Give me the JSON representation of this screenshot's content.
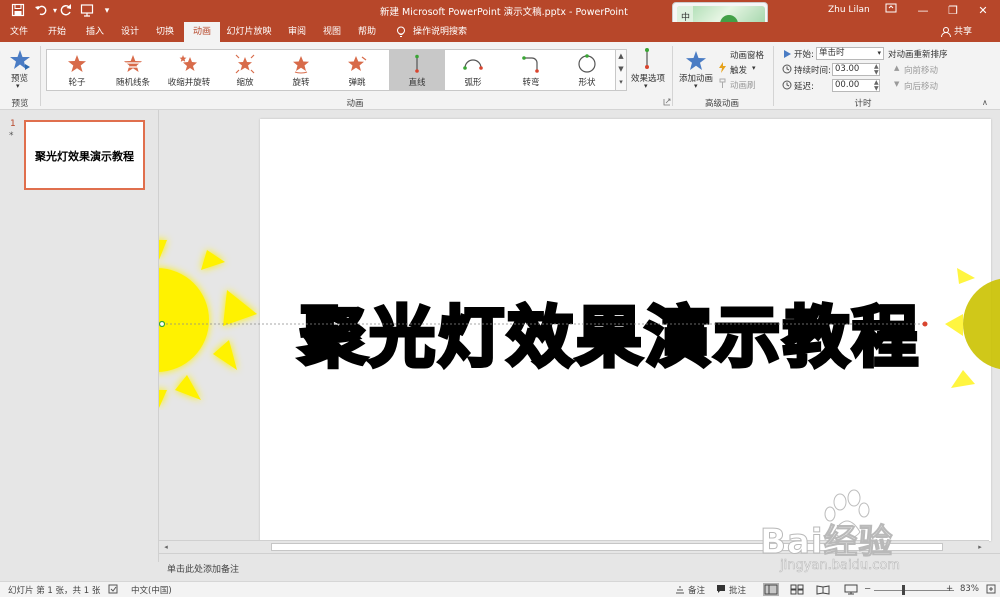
{
  "titlebar": {
    "doc_title": "新建 Microsoft PowerPoint 演示文稿.pptx  -  PowerPoint",
    "user": "Zhu Lilan"
  },
  "tabs": [
    {
      "label": "文件"
    },
    {
      "label": "开始"
    },
    {
      "label": "插入"
    },
    {
      "label": "设计"
    },
    {
      "label": "切换"
    },
    {
      "label": "动画"
    },
    {
      "label": "幻灯片放映"
    },
    {
      "label": "审阅"
    },
    {
      "label": "视图"
    },
    {
      "label": "帮助"
    }
  ],
  "tell_me": "操作说明搜索",
  "share": "共享",
  "ribbon": {
    "preview_label": "预览",
    "preview_group": "预览",
    "animations": [
      {
        "label": "轮子",
        "active": false
      },
      {
        "label": "随机线条",
        "active": false
      },
      {
        "label": "收缩并旋转",
        "active": false
      },
      {
        "label": "缩放",
        "active": false
      },
      {
        "label": "旋转",
        "active": false
      },
      {
        "label": "弹跳",
        "active": false
      },
      {
        "label": "直线",
        "active": true
      },
      {
        "label": "弧形",
        "active": false
      },
      {
        "label": "转弯",
        "active": false
      },
      {
        "label": "形状",
        "active": false
      }
    ],
    "effect_options": "效果选项",
    "animation_group": "动画",
    "add_animation": "添加动画",
    "animation_pane": "动画窗格",
    "trigger": "触发",
    "animation_painter": "动画刷",
    "advanced_group": "高级动画",
    "start_label": "开始:",
    "start_value": "单击时",
    "duration_label": "持续时间:",
    "duration_value": "03.00",
    "delay_label": "延迟:",
    "delay_value": "00.00",
    "reorder_title": "对动画重新排序",
    "move_earlier": "向前移动",
    "move_later": "向后移动",
    "timing_group": "计时"
  },
  "thumbnails": {
    "slide_number": "1",
    "star": "*",
    "thumb_text": "聚光灯效果演示教程"
  },
  "slide": {
    "title": "聚光灯效果演示教程"
  },
  "notes_placeholder": "单击此处添加备注",
  "status": {
    "slide_info": "幻灯片 第 1 张，共 1 张",
    "language": "中文(中国)",
    "notes": "备注",
    "comments": "批注",
    "zoom": "83%"
  },
  "watermark": {
    "line1": "Bai经验",
    "line2": "jingyan.baidu.com"
  },
  "colors": {
    "accent": "#b7472a",
    "sun": "#fff200",
    "selection": "#e06f4d"
  }
}
